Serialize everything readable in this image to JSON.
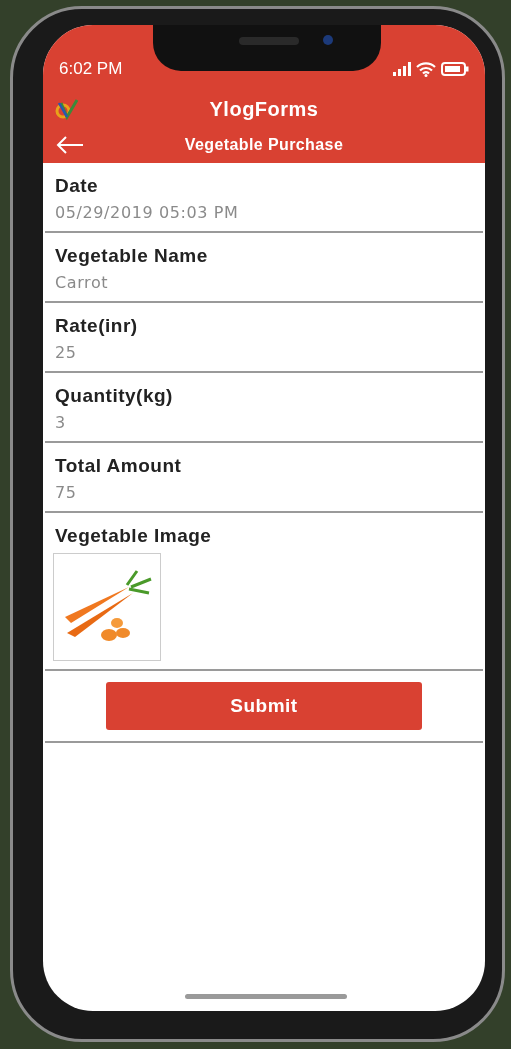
{
  "status_bar": {
    "time": "6:02 PM"
  },
  "app": {
    "title": "YlogForms"
  },
  "page": {
    "title": "Vegetable Purchase"
  },
  "fields": [
    {
      "kind": "text",
      "label": "Date",
      "value": "05/29/2019 05:03 PM"
    },
    {
      "kind": "text",
      "label": "Vegetable Name",
      "value": "Carrot"
    },
    {
      "kind": "text",
      "label": "Rate(inr)",
      "value": "25"
    },
    {
      "kind": "text",
      "label": "Quantity(kg)",
      "value": "3"
    },
    {
      "kind": "text",
      "label": "Total Amount",
      "value": "75"
    },
    {
      "kind": "image",
      "label": "Vegetable Image"
    }
  ],
  "submit": {
    "label": "Submit"
  }
}
